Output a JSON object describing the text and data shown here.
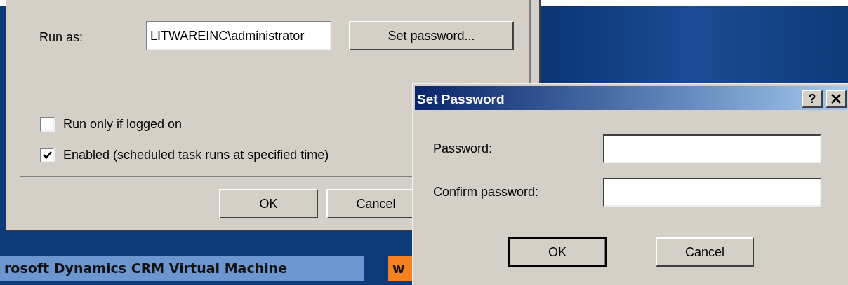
{
  "task_dialog": {
    "run_as_label": "Run as:",
    "run_as_value": "LITWAREINC\\administrator",
    "set_password_button": "Set password...",
    "checkboxes": [
      {
        "label": "Run only if logged on",
        "checked": false
      },
      {
        "label": "Enabled (scheduled task runs at specified time)",
        "checked": true
      }
    ],
    "buttons": [
      "OK",
      "Cancel"
    ]
  },
  "set_password_dialog": {
    "title": "Set Password",
    "help_button": "?",
    "fields": [
      {
        "label": "Password:"
      },
      {
        "label": "Confirm password:"
      }
    ],
    "buttons": [
      {
        "label": "OK",
        "default": true
      },
      {
        "label": "Cancel",
        "default": false
      }
    ]
  },
  "taskbar_items": [
    {
      "label": "rosoft Dynamics CRM Virtual Machine",
      "color": "#6b96d0"
    },
    {
      "label": "w",
      "color": "#f5821f"
    }
  ]
}
